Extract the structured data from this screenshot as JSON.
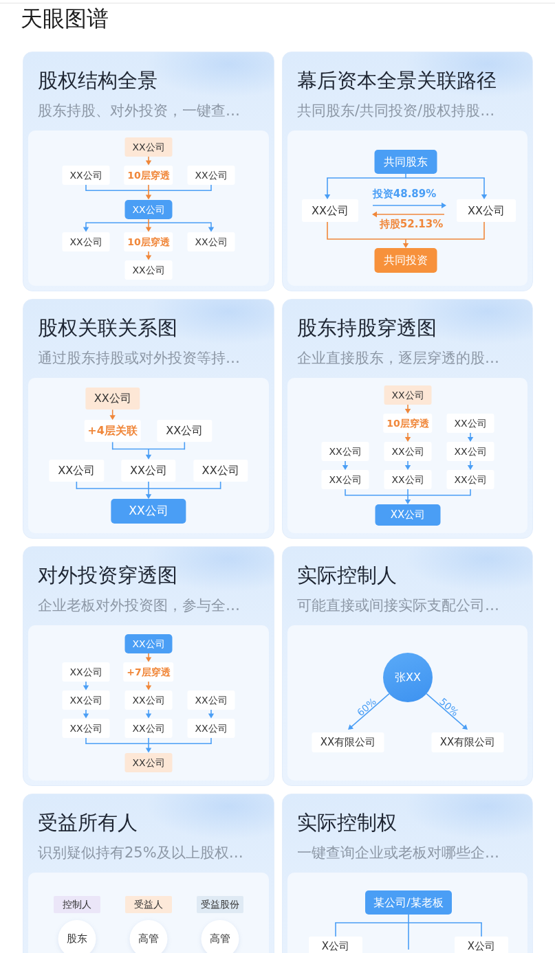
{
  "header": {
    "title": "天眼图谱"
  },
  "cards": [
    {
      "title": "股权结构全景",
      "subtitle": "股东持股、对外投资，一键查…",
      "diagram": {
        "kind": "grid",
        "rows": [
          {
            "connector": {
              "kind": "straight"
            },
            "cells": [
              null,
              {
                "kind": "accent",
                "text": "XX公司"
              },
              null
            ]
          },
          {
            "connector": {
              "kind": "merge"
            },
            "cells": [
              {
                "kind": "plain",
                "text": "XX公司"
              },
              {
                "kind": "layers",
                "text": "10层穿透"
              },
              {
                "kind": "plain",
                "text": "XX公司"
              }
            ]
          },
          {
            "connector": {
              "kind": "split"
            },
            "cells": [
              null,
              {
                "kind": "primary",
                "text": "XX公司"
              },
              null
            ]
          },
          {
            "connector": {
              "kind": "straight"
            },
            "cells": [
              {
                "kind": "plain",
                "text": "XX公司"
              },
              {
                "kind": "layers",
                "text": "10层穿透"
              },
              {
                "kind": "plain",
                "text": "XX公司"
              }
            ]
          },
          {
            "cells": [
              null,
              {
                "kind": "plain",
                "text": "XX公司"
              },
              null
            ]
          }
        ]
      }
    },
    {
      "title": "幕后资本全景关联路径",
      "subtitle": "共同股东/共同投资/股权持股…",
      "diagram": {
        "kind": "relation",
        "top": "共同股东",
        "left": "XX公司",
        "right": "XX公司",
        "forward": "投资48.89%",
        "backward": "持股52.13%",
        "bottom": "共同投资"
      }
    },
    {
      "title": "股权关联关系图",
      "subtitle": "通过股东持股或对外投资等持…",
      "diagram": {
        "kind": "grid",
        "rows": [
          {
            "connector": {
              "kind": "straight"
            },
            "cells": [
              {
                "kind": "accent",
                "text": "XX公司"
              },
              null
            ]
          },
          {
            "connector": {
              "kind": "merge"
            },
            "cells": [
              {
                "kind": "layers",
                "text": "+4层关联"
              },
              {
                "kind": "plain",
                "text": "XX公司"
              }
            ]
          },
          {
            "connector": {
              "kind": "merge"
            },
            "cells": [
              {
                "kind": "plain",
                "text": "XX公司"
              },
              {
                "kind": "plain",
                "text": "XX公司"
              },
              {
                "kind": "plain",
                "text": "XX公司"
              }
            ]
          },
          {
            "cells": [
              {
                "kind": "primary",
                "text": "XX公司"
              }
            ]
          }
        ]
      }
    },
    {
      "title": "股东持股穿透图",
      "subtitle": "企业直接股东，逐层穿透的股…",
      "diagram": {
        "kind": "grid",
        "rows": [
          {
            "connector": {
              "kind": "straight"
            },
            "cells": [
              null,
              {
                "kind": "accent",
                "text": "XX公司"
              },
              null
            ]
          },
          {
            "connector": {
              "kind": "straight"
            },
            "cells": [
              null,
              {
                "kind": "layers",
                "text": "10层穿透"
              },
              {
                "kind": "plain",
                "text": "XX公司"
              }
            ]
          },
          {
            "connector": {
              "kind": "straight"
            },
            "cells": [
              {
                "kind": "plain",
                "text": "XX公司"
              },
              {
                "kind": "plain",
                "text": "XX公司"
              },
              {
                "kind": "plain",
                "text": "XX公司"
              }
            ]
          },
          {
            "connector": {
              "kind": "merge"
            },
            "cells": [
              {
                "kind": "plain",
                "text": "XX公司"
              },
              {
                "kind": "plain",
                "text": "XX公司"
              },
              {
                "kind": "plain",
                "text": "XX公司"
              }
            ]
          },
          {
            "cells": [
              null,
              {
                "kind": "primary",
                "text": "XX公司"
              },
              null
            ]
          }
        ]
      }
    },
    {
      "title": "对外投资穿透图",
      "subtitle": "企业老板对外投资图，参与全…",
      "diagram": {
        "kind": "grid",
        "rows": [
          {
            "connector": {
              "kind": "straight"
            },
            "cells": [
              null,
              {
                "kind": "primary",
                "text": "XX公司"
              },
              null
            ]
          },
          {
            "connector": {
              "kind": "straight"
            },
            "cells": [
              {
                "kind": "plain",
                "text": "XX公司"
              },
              {
                "kind": "layers",
                "text": "+7层穿透"
              },
              null
            ]
          },
          {
            "connector": {
              "kind": "straight"
            },
            "cells": [
              {
                "kind": "plain",
                "text": "XX公司"
              },
              {
                "kind": "plain",
                "text": "XX公司"
              },
              {
                "kind": "plain",
                "text": "XX公司"
              }
            ]
          },
          {
            "connector": {
              "kind": "merge"
            },
            "cells": [
              {
                "kind": "plain",
                "text": "XX公司"
              },
              {
                "kind": "plain",
                "text": "XX公司"
              },
              {
                "kind": "plain",
                "text": "XX公司"
              }
            ]
          },
          {
            "cells": [
              null,
              {
                "kind": "accent",
                "text": "XX公司"
              },
              null
            ]
          }
        ]
      }
    },
    {
      "title": "实际控制人",
      "subtitle": "可能直接或间接实际支配公司…",
      "diagram": {
        "kind": "controller",
        "person": "张XX",
        "branches": [
          {
            "share": "60%",
            "company": "XX有限公司"
          },
          {
            "share": "50%",
            "company": "XX有限公司"
          }
        ]
      }
    },
    {
      "title": "受益所有人",
      "subtitle": "识别疑似持有25%及以上股权…",
      "diagram": {
        "kind": "roles",
        "columns": [
          {
            "tag": "控制人",
            "color": "#ebe6f8",
            "node": "股东"
          },
          {
            "tag": "受益人",
            "color": "#fde9d9",
            "node": "高管"
          },
          {
            "tag": "受益股份",
            "color": "#dfeaf4",
            "node": "高管"
          }
        ]
      }
    },
    {
      "title": "实际控制权",
      "subtitle": "一键查询企业或老板对哪些企…",
      "diagram": {
        "kind": "holdings",
        "top": "某公司/某老板",
        "children": [
          "X公司",
          "X公司"
        ]
      }
    }
  ]
}
